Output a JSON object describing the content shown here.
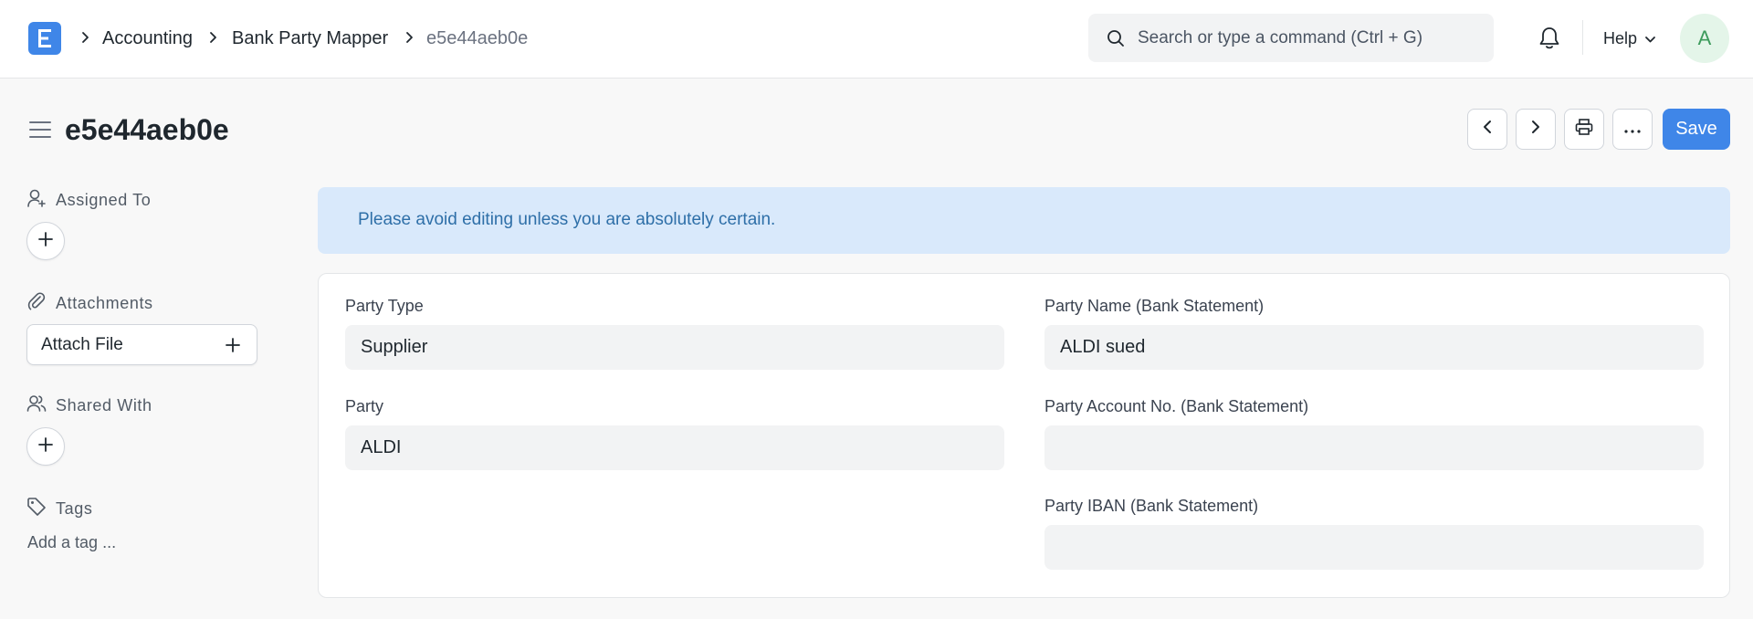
{
  "navbar": {
    "logo_icon": "app-logo-icon",
    "breadcrumbs": [
      "Accounting",
      "Bank Party Mapper",
      "e5e44aeb0e"
    ],
    "search_placeholder": "Search or type a command (Ctrl + G)",
    "help_label": "Help",
    "avatar_initial": "A"
  },
  "page": {
    "title": "e5e44aeb0e",
    "save_label": "Save"
  },
  "sidebar": {
    "assigned_to": "Assigned To",
    "attachments": "Attachments",
    "attach_file": "Attach File",
    "shared_with": "Shared With",
    "tags": "Tags",
    "add_tag": "Add a tag ..."
  },
  "alert": {
    "message": "Please avoid editing unless you are absolutely certain."
  },
  "form": {
    "party_type": {
      "label": "Party Type",
      "value": "Supplier"
    },
    "party": {
      "label": "Party",
      "value": "ALDI"
    },
    "party_name": {
      "label": "Party Name (Bank Statement)",
      "value": "ALDI sued"
    },
    "party_account_no": {
      "label": "Party Account No. (Bank Statement)",
      "value": ""
    },
    "party_iban": {
      "label": "Party IBAN (Bank Statement)",
      "value": ""
    }
  },
  "colors": {
    "primary": "#3f86e8",
    "alert_bg": "#d9e9fb",
    "alert_text": "#2e6fa8",
    "avatar_bg": "#e4f5e9",
    "avatar_text": "#3d9b5c"
  }
}
